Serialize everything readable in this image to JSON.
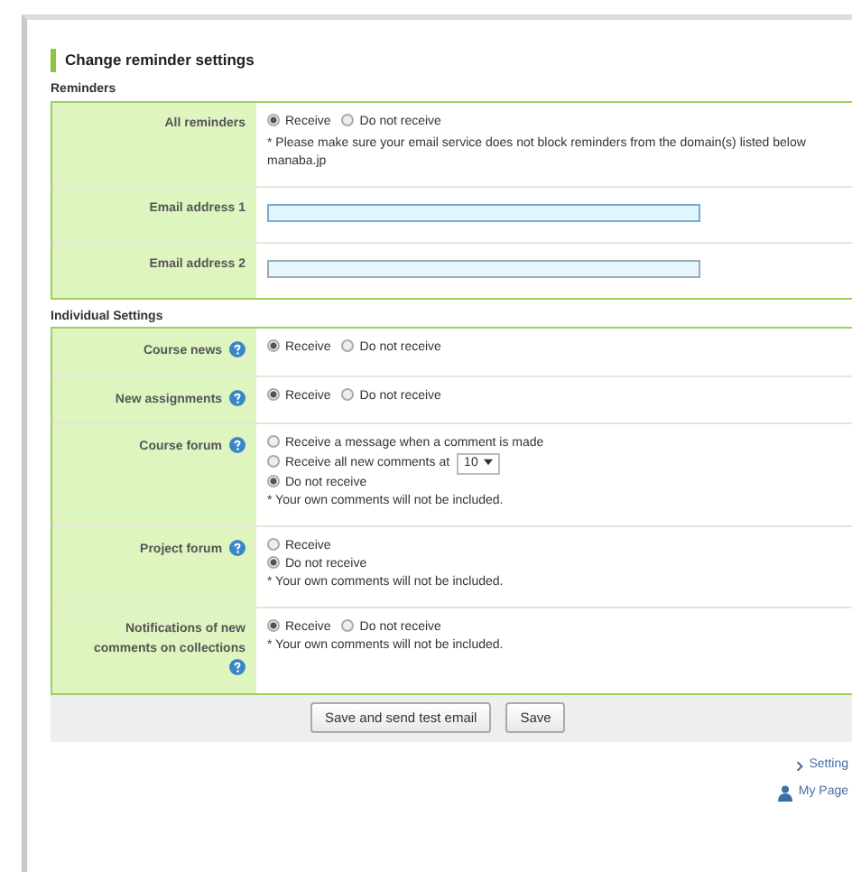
{
  "heading": "Change reminder settings",
  "sections": [
    {
      "title": "Reminders",
      "rows": [
        {
          "kind": "radio-row",
          "label": "All reminders",
          "help": false,
          "options": [
            {
              "label": "Receive",
              "selected": true
            },
            {
              "label": "Do not receive",
              "selected": false
            }
          ],
          "notes": [
            "* Please make sure your email service does not block reminders from the domain(s) listed below",
            "manaba.jp"
          ]
        },
        {
          "kind": "email",
          "label": "Email address 1",
          "help": false,
          "focused": true
        },
        {
          "kind": "email",
          "label": "Email address 2",
          "help": false,
          "focused": false
        }
      ]
    },
    {
      "title": "Individual Settings",
      "rows": [
        {
          "kind": "radio-row",
          "label": "Course news",
          "help": true,
          "options": [
            {
              "label": "Receive",
              "selected": true
            },
            {
              "label": "Do not receive",
              "selected": false
            }
          ]
        },
        {
          "kind": "radio-row",
          "label": "New assignments",
          "help": true,
          "options": [
            {
              "label": "Receive",
              "selected": true
            },
            {
              "label": "Do not receive",
              "selected": false
            }
          ]
        },
        {
          "kind": "radio-stack",
          "label": "Course forum",
          "help": true,
          "options": [
            {
              "label": "Receive a message when a comment is made",
              "selected": false
            },
            {
              "label": "Receive all new comments at",
              "selected": false,
              "select_value": "10"
            },
            {
              "label": "Do not receive",
              "selected": true
            }
          ],
          "notes": [
            "* Your own comments will not be included."
          ]
        },
        {
          "kind": "radio-stack",
          "label": "Project forum",
          "help": true,
          "options": [
            {
              "label": "Receive",
              "selected": false
            },
            {
              "label": "Do not receive",
              "selected": true
            }
          ],
          "notes": [
            "* Your own comments will not be included."
          ]
        },
        {
          "kind": "radio-row",
          "label": "Notifications of new comments on collections",
          "help": true,
          "options": [
            {
              "label": "Receive",
              "selected": true
            },
            {
              "label": "Do not receive",
              "selected": false
            }
          ],
          "notes": [
            "* Your own comments will not be included."
          ]
        }
      ]
    }
  ],
  "buttons": [
    "Save and send test email",
    "Save"
  ],
  "links": [
    {
      "kind": "chevron",
      "label": "Setting"
    },
    {
      "kind": "person",
      "label": "My Page"
    }
  ]
}
